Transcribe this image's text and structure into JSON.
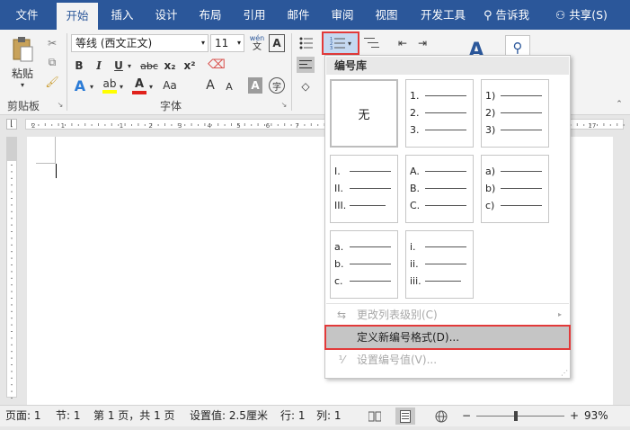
{
  "tabs": [
    {
      "label": "文件"
    },
    {
      "label": "开始"
    },
    {
      "label": "插入"
    },
    {
      "label": "设计"
    },
    {
      "label": "布局"
    },
    {
      "label": "引用"
    },
    {
      "label": "邮件"
    },
    {
      "label": "审阅"
    },
    {
      "label": "视图"
    },
    {
      "label": "开发工具"
    }
  ],
  "tell_me": "告诉我",
  "share": "共享(S)",
  "ribbon": {
    "clipboard": {
      "paste_label": "粘贴",
      "group_label": "剪贴板"
    },
    "font": {
      "font_name": "等线 (西文正文)",
      "font_size": "11",
      "wen_top": "wén",
      "wen_bottom": "文",
      "bold": "B",
      "italic": "I",
      "underline": "U",
      "strike": "abc",
      "subscript": "x₂",
      "superscript": "x²",
      "grow": "A",
      "shrink": "A",
      "shade": "A",
      "enclose": "字",
      "group_label": "字体"
    }
  },
  "numbering_gallery": {
    "title": "编号库",
    "none_label": "无",
    "formats": [
      [
        "1.",
        "2.",
        "3."
      ],
      [
        "1)",
        "2)",
        "3)"
      ],
      [
        "I.",
        "II.",
        "III."
      ],
      [
        "A.",
        "B.",
        "C."
      ],
      [
        "a)",
        "b)",
        "c)"
      ],
      [
        "a.",
        "b.",
        "c."
      ],
      [
        "i.",
        "ii.",
        "iii."
      ]
    ],
    "menu": [
      {
        "label": "更改列表级别(C)",
        "disabled": true
      },
      {
        "label": "定义新编号格式(D)...",
        "disabled": false
      },
      {
        "label": "设置编号值(V)...",
        "disabled": true
      }
    ]
  },
  "statusbar": {
    "page": "页面: 1",
    "section": "节: 1",
    "pages": "第 1 页，共 1 页",
    "position": "设置值: 2.5厘米",
    "line": "行: 1",
    "column": "列: 1",
    "zoom": "93%"
  },
  "colors": {
    "accent": "#2b579a",
    "highlight": "#e23a3a"
  }
}
